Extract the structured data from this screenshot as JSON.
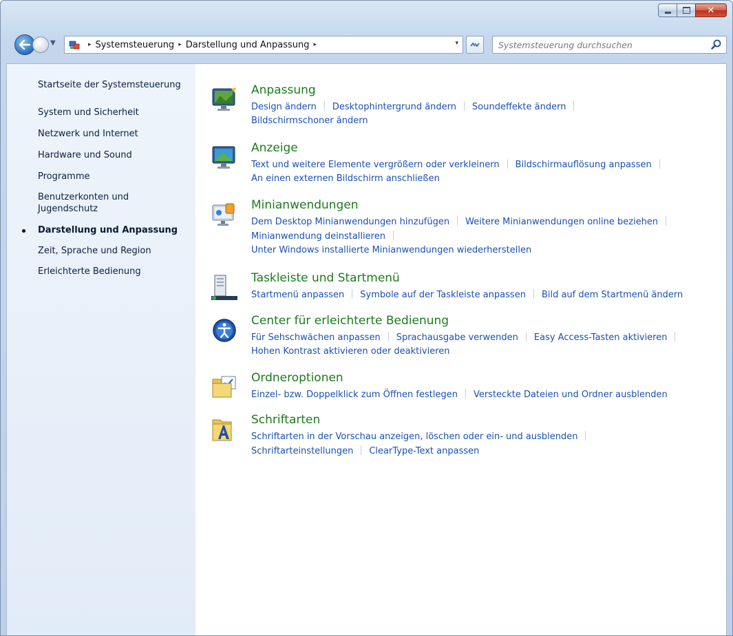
{
  "window": {
    "caption": {
      "minimize": "–",
      "maximize": "□",
      "close": "✕"
    }
  },
  "address": {
    "segments": [
      "Systemsteuerung",
      "Darstellung und Anpassung"
    ],
    "separator": "▸",
    "dropdown": "▾"
  },
  "search": {
    "placeholder": "Systemsteuerung durchsuchen"
  },
  "nav_pane": {
    "items": [
      {
        "label": "Startseite der Systemsteuerung"
      },
      {
        "label": "System und Sicherheit"
      },
      {
        "label": "Netzwerk und Internet"
      },
      {
        "label": "Hardware und Sound"
      },
      {
        "label": "Programme"
      },
      {
        "label_line1": "Benutzerkonten und",
        "label_line2": "Jugendschutz"
      },
      {
        "label": "Darstellung und Anpassung"
      },
      {
        "label": "Zeit, Sprache und Region"
      },
      {
        "label": "Erleichterte Bedienung"
      }
    ]
  },
  "categories": [
    {
      "title": "Anpassung",
      "icon": "desktop-personalize-icon",
      "links": [
        [
          "Design ändern",
          "Desktophintergrund ändern",
          "Soundeffekte ändern"
        ],
        [
          "Bildschirmschoner ändern"
        ]
      ]
    },
    {
      "title": "Anzeige",
      "icon": "display-monitor-icon",
      "links": [
        [
          "Text und weitere Elemente vergrößern oder verkleinern",
          "Bildschirmauflösung anpassen"
        ],
        [
          "An einen externen Bildschirm anschließen"
        ]
      ]
    },
    {
      "title": "Minianwendungen",
      "icon": "gadgets-icon",
      "links": [
        [
          "Dem Desktop Minianwendungen hinzufügen",
          "Weitere Minianwendungen online beziehen"
        ],
        [
          "Minianwendung deinstallieren"
        ],
        [
          "Unter Windows installierte Minianwendungen wiederherstellen"
        ]
      ]
    },
    {
      "title": "Taskleiste und Startmenü",
      "icon": "taskbar-icon",
      "links": [
        [
          "Startmenü anpassen",
          "Symbole auf der Taskleiste anpassen",
          "Bild auf dem Startmenü ändern"
        ]
      ]
    },
    {
      "title": "Center für erleichterte Bedienung",
      "icon": "ease-of-access-icon",
      "links": [
        [
          "Für Sehschwächen anpassen",
          "Sprachausgabe verwenden",
          "Easy Access-Tasten aktivieren"
        ],
        [
          "Hohen Kontrast aktivieren oder deaktivieren"
        ]
      ]
    },
    {
      "title": "Ordneroptionen",
      "icon": "folder-options-icon",
      "links": [
        [
          "Einzel- bzw. Doppelklick zum Öffnen festlegen",
          "Versteckte Dateien und Ordner ausblenden"
        ]
      ]
    },
    {
      "title": "Schriftarten",
      "icon": "fonts-icon",
      "links": [
        [
          "Schriftarten in der Vorschau anzeigen, löschen oder ein- und ausblenden"
        ],
        [
          "Schriftarteinstellungen",
          "ClearType-Text anpassen"
        ]
      ]
    }
  ],
  "colors": {
    "category_title": "#1c7b1c",
    "link": "#1a4fb3",
    "nav_text": "#0a2040"
  }
}
